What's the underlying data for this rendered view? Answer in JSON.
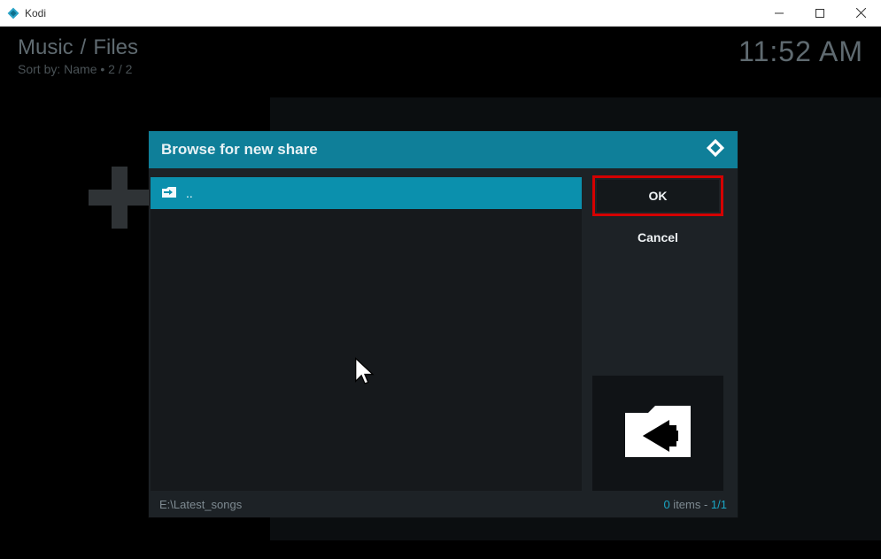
{
  "window": {
    "title": "Kodi"
  },
  "header": {
    "breadcrumb_main": "Music",
    "breadcrumb_sep": "/",
    "breadcrumb_sub": "Files",
    "sort_line": "Sort by: Name  •  2 / 2",
    "clock": "11:52 AM"
  },
  "dialog": {
    "title": "Browse for new share",
    "list_entry": "..",
    "buttons": {
      "ok": "OK",
      "cancel": "Cancel"
    },
    "path": "E:\\Latest_songs",
    "footer_count_num": "0",
    "footer_count_label": " items - ",
    "footer_page": "1/1"
  }
}
